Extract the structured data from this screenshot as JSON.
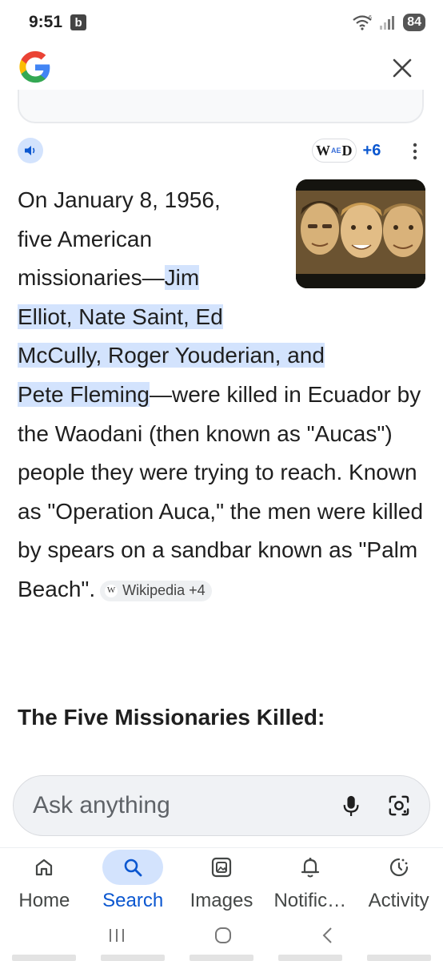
{
  "status": {
    "time": "9:51",
    "badge": "b",
    "battery": "84"
  },
  "answer": {
    "line1": "On January 8, 1956,",
    "line2": "five American",
    "line3_pre": "missionaries—",
    "highlight_a": "Jim",
    "highlight_b": "Elliot, Nate Saint, Ed",
    "highlight_c": "McCully, Roger Youderian, and",
    "highlight_d": "Pete Fleming",
    "rest": "—were killed in Ecuador by the Waodani (then known as \"Aucas\") people they were trying to reach. Known as \"Operation Auca,\" the men were killed by spears on a sandbar known as \"Palm Beach\"."
  },
  "sources": {
    "logo_left": "W",
    "logo_mid": "AE",
    "logo_right": "D",
    "count": "+6"
  },
  "citation": {
    "w": "W",
    "label": "Wikipedia +4"
  },
  "section_heading": "The Five Missionaries Killed:",
  "ask": {
    "placeholder": "Ask anything"
  },
  "nav": {
    "items": [
      {
        "label": "Home",
        "icon": "home-icon"
      },
      {
        "label": "Search",
        "icon": "search-icon"
      },
      {
        "label": "Images",
        "icon": "images-icon"
      },
      {
        "label": "Notific…",
        "icon": "bell-icon"
      },
      {
        "label": "Activity",
        "icon": "activity-icon"
      }
    ],
    "active": "Search"
  },
  "colors": {
    "accent": "#0b57d0",
    "highlight": "#d3e3fd"
  }
}
